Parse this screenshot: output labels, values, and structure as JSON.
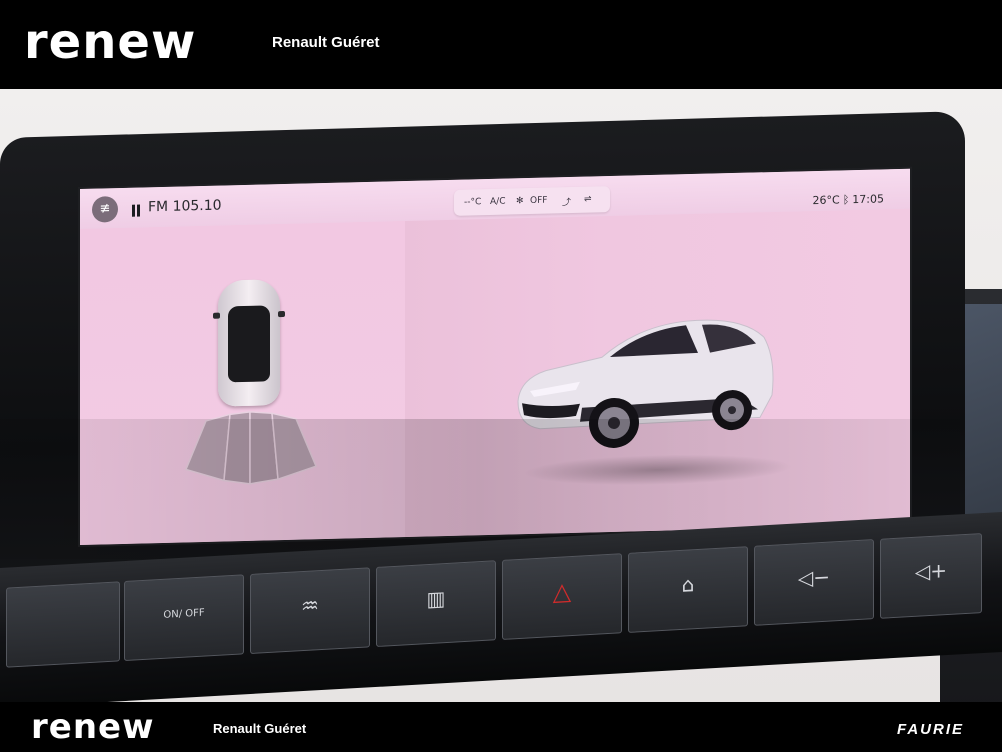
{
  "header": {
    "logo": "renew",
    "dealer": "Renault Guéret"
  },
  "infotainment": {
    "fog_icon": "fog-light-icon",
    "radio": "FM 105.10",
    "climate": {
      "temp": "--°C",
      "ac": "A/C",
      "fan": "OFF"
    },
    "outside_temp": "26°C",
    "time": "17:05"
  },
  "hardware_buttons": [
    {
      "icon": "fan-power-icon",
      "label": "ON/ OFF"
    },
    {
      "icon": "front-defrost-icon",
      "label": ""
    },
    {
      "icon": "rear-defrost-icon",
      "label": ""
    },
    {
      "icon": "hazard-icon",
      "label": ""
    },
    {
      "icon": "home-icon",
      "label": ""
    },
    {
      "icon": "volume-down-icon",
      "label": ""
    },
    {
      "icon": "volume-up-icon",
      "label": ""
    }
  ],
  "footer": {
    "logo": "renew",
    "dealer": "Renault Guéret",
    "brand": "FAURIE"
  }
}
